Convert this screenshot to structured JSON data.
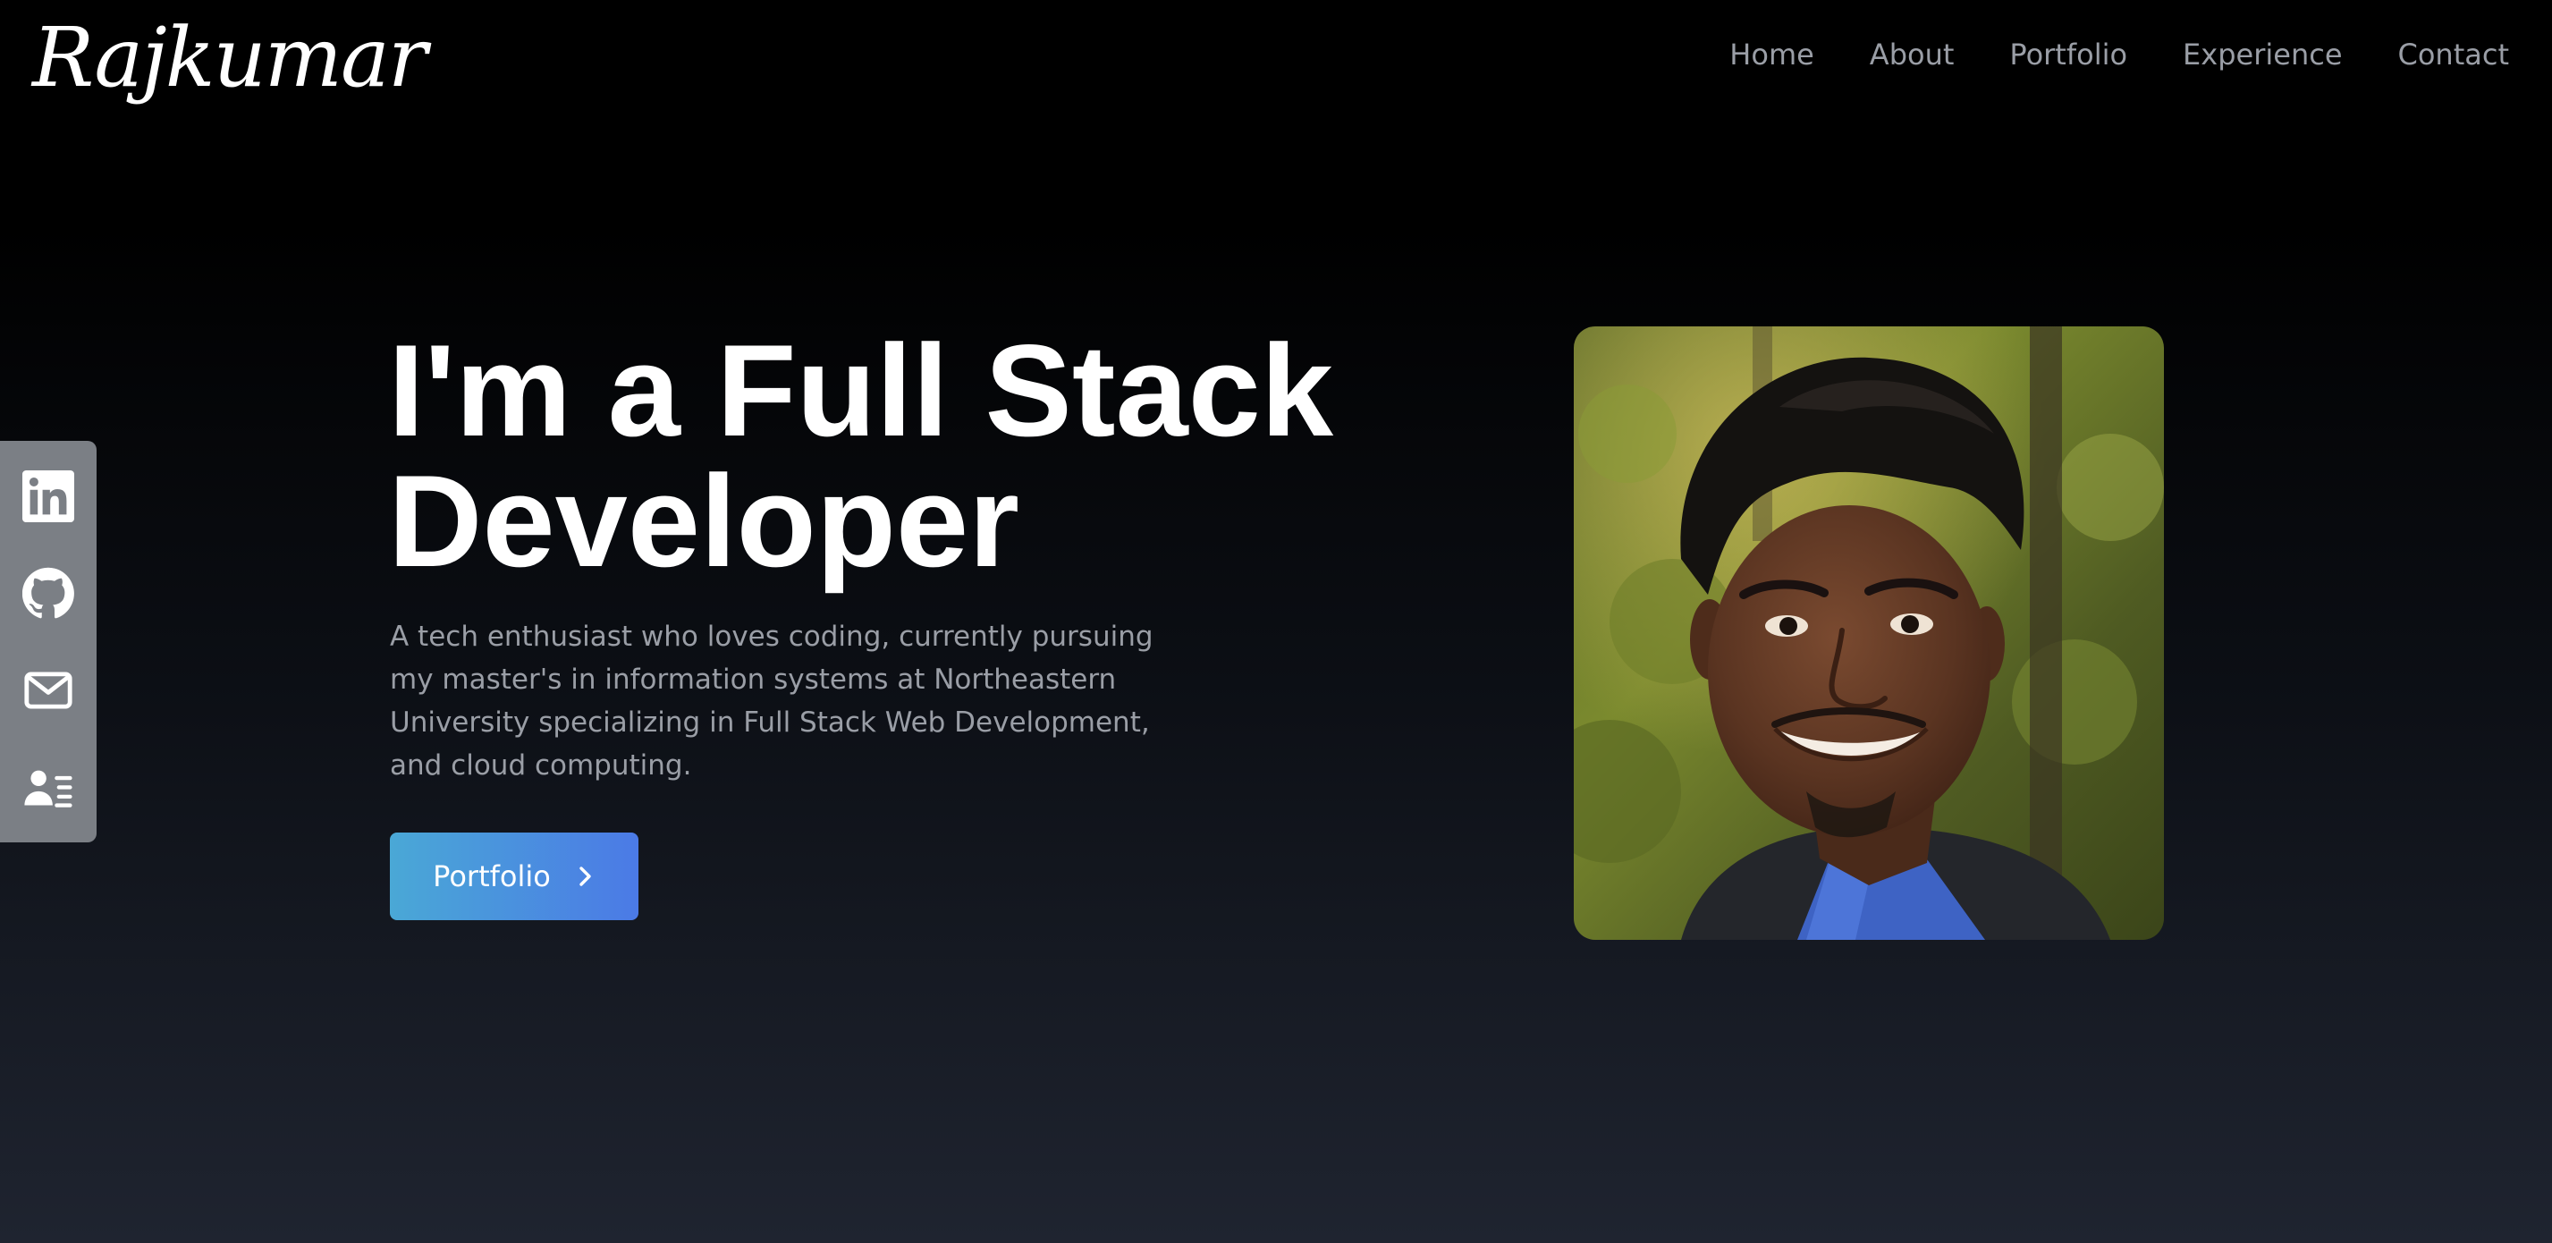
{
  "header": {
    "logo_text": "Rajkumar",
    "nav": [
      {
        "label": "Home"
      },
      {
        "label": "About"
      },
      {
        "label": "Portfolio"
      },
      {
        "label": "Experience"
      },
      {
        "label": "Contact"
      }
    ]
  },
  "social": [
    {
      "icon": "linkedin-icon"
    },
    {
      "icon": "github-icon"
    },
    {
      "icon": "mail-icon"
    },
    {
      "icon": "contact-card-icon"
    }
  ],
  "hero": {
    "title_line1": "I'm a Full Stack",
    "title_line2": "Developer",
    "description": "A tech enthusiast who loves coding, currently pursuing my master's in information systems at Northeastern University specializing in Full Stack Web Development, and cloud computing.",
    "cta_label": "Portfolio",
    "cta_icon": "chevron-right-icon"
  },
  "portrait": {
    "kind": "profile-photo"
  },
  "colors": {
    "nav_text": "#9a9ea6",
    "sidebar_bg": "#7b7f85",
    "cta_start": "#4aa8d6",
    "cta_end": "#4b7ae6"
  }
}
